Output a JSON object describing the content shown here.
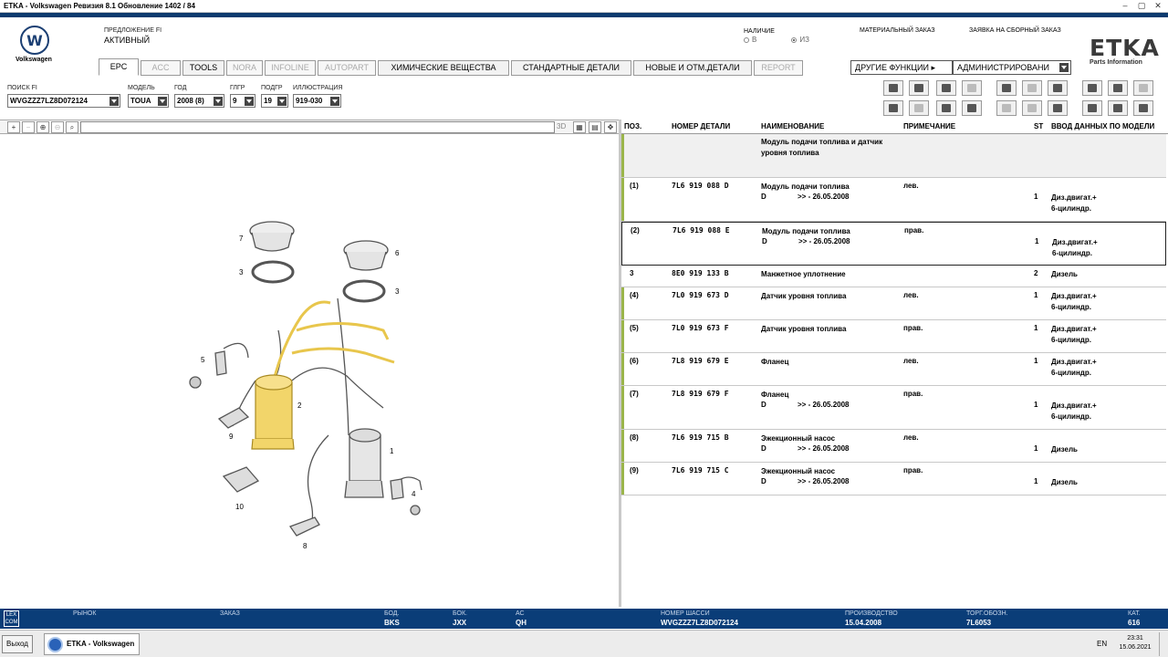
{
  "window": {
    "title": "ETKA - Volkswagen Ревизия 8.1 Обновление 1402 / 84",
    "min": "–",
    "max": "▢",
    "close": "✕"
  },
  "header": {
    "brand": "Volkswagen",
    "fi_label": "ПРЕДЛОЖЕНИЕ FI",
    "fi_value": "АКТИВНЫЙ",
    "availability_label": "НАЛИЧИЕ",
    "radio_b": "В",
    "radio_iz": "ИЗ",
    "material_order": "МАТЕРИАЛЬНЫЙ ЗАКАЗ",
    "assembly_order": "ЗАЯВКА НА СБОРНЫЙ ЗАКАЗ",
    "etka": "ETKA",
    "etka_sub": "Parts Information"
  },
  "tabs": [
    {
      "label": "EPC",
      "state": "active"
    },
    {
      "label": "ACC",
      "state": "disabled"
    },
    {
      "label": "TOOLS",
      "state": "enabled"
    },
    {
      "label": "NORA",
      "state": "disabled"
    },
    {
      "label": "INFOLINE",
      "state": "disabled"
    },
    {
      "label": "AUTOPART",
      "state": "disabled"
    },
    {
      "label": "ХИМИЧЕСКИЕ ВЕЩЕСТВА",
      "state": "enabled"
    },
    {
      "label": "СТАНДАРТНЫЕ ДЕТАЛИ",
      "state": "enabled"
    },
    {
      "label": "НОВЫЕ И ОТМ.ДЕТАЛИ",
      "state": "enabled"
    },
    {
      "label": "REPORT",
      "state": "disabled"
    }
  ],
  "other_functions": "ДРУГИЕ ФУНКЦИИ ▸",
  "admin": "АДМИНИСТРИРОВАНИ",
  "filters": {
    "search_fi": {
      "label": "ПОИСК FI",
      "value": "WVGZZZ7LZ8D072124"
    },
    "model": {
      "label": "МОДЕЛЬ",
      "value": "TOUA"
    },
    "year": {
      "label": "ГОД",
      "value": "2008 (8)"
    },
    "mg": {
      "label": "ГЛГР",
      "value": "9"
    },
    "sg": {
      "label": "ПОДГР",
      "value": "19"
    },
    "illustration": {
      "label": "ИЛЛЮСТРАЦИЯ",
      "value": "919-030"
    }
  },
  "illu_toolbar": {
    "mode3d": "3D"
  },
  "table": {
    "headers": {
      "pos": "ПОЗ.",
      "part_no": "НОМЕР ДЕТАЛИ",
      "name": "НАИМЕНОВАНИЕ",
      "note": "ПРИМЕЧАНИЕ",
      "st": "ST",
      "model": "ВВОД ДАННЫХ ПО МОДЕЛИ"
    },
    "group_title_1": "Модуль подачи топлива и датчик",
    "group_title_2": "уровня топлива",
    "rows": [
      {
        "pos": "(1)",
        "pn": "7L6  919  088  D",
        "name": "Модуль подачи топлива",
        "sub": "D",
        "date": ">> - 26.05.2008",
        "note": "лев.",
        "st": "1",
        "m1": "Диз.двигат.+",
        "m2": "6-цилиндр."
      },
      {
        "pos": "(2)",
        "pn": "7L6  919  088  E",
        "name": "Модуль подачи топлива",
        "sub": "D",
        "date": ">> - 26.05.2008",
        "note": "прав.",
        "st": "1",
        "m1": "Диз.двигат.+",
        "m2": "6-цилиндр."
      },
      {
        "pos": "3",
        "pn": "8E0  919  133  B",
        "name": "Манжетное уплотнение",
        "sub": "",
        "date": "",
        "note": "",
        "st": "2",
        "m1": "Дизель",
        "m2": ""
      },
      {
        "pos": "(4)",
        "pn": "7L0  919  673  D",
        "name": "Датчик уровня топлива",
        "sub": "",
        "date": "",
        "note": "лев.",
        "st": "1",
        "m1": "Диз.двигат.+",
        "m2": "6-цилиндр."
      },
      {
        "pos": "(5)",
        "pn": "7L0  919  673  F",
        "name": "Датчик уровня топлива",
        "sub": "",
        "date": "",
        "note": "прав.",
        "st": "1",
        "m1": "Диз.двигат.+",
        "m2": "6-цилиндр."
      },
      {
        "pos": "(6)",
        "pn": "7L8  919  679  E",
        "name": "Фланец",
        "sub": "",
        "date": "",
        "note": "лев.",
        "st": "1",
        "m1": "Диз.двигат.+",
        "m2": "6-цилиндр."
      },
      {
        "pos": "(7)",
        "pn": "7L8  919  679  F",
        "name": "Фланец",
        "sub": "D",
        "date": ">> - 26.05.2008",
        "note": "прав.",
        "st": "1",
        "m1": "Диз.двигат.+",
        "m2": "6-цилиндр."
      },
      {
        "pos": "(8)",
        "pn": "7L6  919  715  B",
        "name": "Эжекционный насос",
        "sub": "D",
        "date": ">> - 26.05.2008",
        "note": "лев.",
        "st": "1",
        "m1": "Дизель",
        "m2": ""
      },
      {
        "pos": "(9)",
        "pn": "7L6  919  715  C",
        "name": "Эжекционный насос",
        "sub": "D",
        "date": ">> - 26.05.2008",
        "note": "прав.",
        "st": "1",
        "m1": "Дизель",
        "m2": ""
      }
    ]
  },
  "illustration_labels": [
    "7",
    "3",
    "6",
    "3",
    "5",
    "2",
    "9",
    "1",
    "10",
    "4",
    "8"
  ],
  "status": {
    "lex": "LEX COM",
    "market_label": "РЫНОК",
    "market": "",
    "order_label": "ЗАКАЗ",
    "order": "",
    "bod_label": "БОД.",
    "bod": "BKS",
    "bok_label": "БОК.",
    "bok": "JXX",
    "ac_label": "АС",
    "ac": "QH",
    "chassis_label": "НОМЕР ШАССИ",
    "chassis": "WVGZZZ7LZ8D072124",
    "prod_label": "ПРОИЗВОДСТВО",
    "prod": "15.04.2008",
    "trade_label": "ТОРГ.ОБОЗН.",
    "trade": "7L6053",
    "cat_label": "КАТ.",
    "cat": "616"
  },
  "taskbar": {
    "exit": "Выход",
    "app": "ETKA - Volkswagen",
    "lang": "EN",
    "time": "23:31",
    "date": "15.06.2021"
  },
  "colors": {
    "accent": "#0a3d78",
    "row_marker": "#9bb54a",
    "highlight_part": "#f2d56a"
  }
}
